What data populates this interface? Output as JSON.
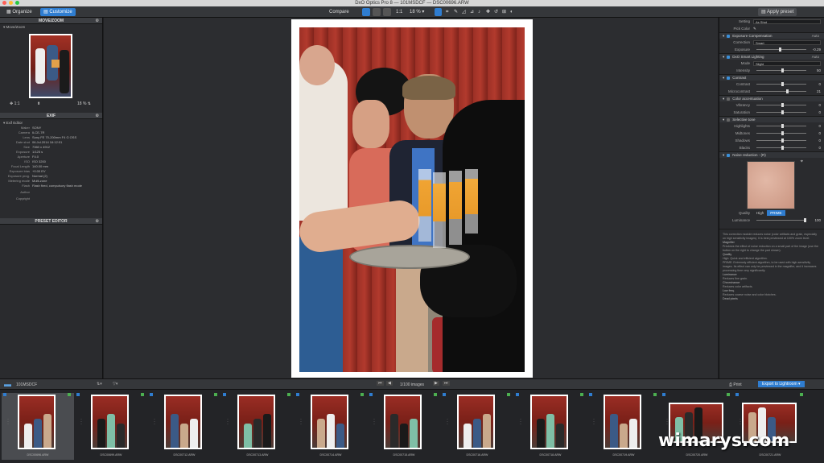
{
  "app": {
    "title": "DxO Optics Pro 8 — 101MSDCF — DSC00696.ARW"
  },
  "toolbar": {
    "tab_organize": "Organize",
    "tab_customize": "Customize",
    "compare": "Compare",
    "zoom_fit": "1:1",
    "zoom_level": "18 %",
    "apply_preset": "Apply preset"
  },
  "left": {
    "move_zoom": {
      "header": "MOVE/ZOOM",
      "sub": "Move/Zoom",
      "fit": "1:1",
      "zoom": "18 %"
    },
    "exif": {
      "header": "EXIF",
      "sub": "Exif Editor",
      "rows": [
        {
          "k": "Maker",
          "v": "SONY"
        },
        {
          "k": "Camera",
          "v": "ILCE-7R"
        },
        {
          "k": "Lens",
          "v": "Sony FE 70-200mm F4 G OSS"
        },
        {
          "k": "Date shot",
          "v": "06.Jul.2014 16:12:01"
        },
        {
          "k": "Size",
          "v": "7360 x 4912"
        },
        {
          "k": "Exposure",
          "v": "1/125 s"
        },
        {
          "k": "Aperture",
          "v": "F4.0"
        },
        {
          "k": "ISO",
          "v": "ISO 3200"
        },
        {
          "k": "Focal Length",
          "v": "140.00 mm"
        },
        {
          "k": "Exposure bias",
          "v": "+0.00 EV"
        },
        {
          "k": "Exposure prog.",
          "v": "Normal (2)"
        },
        {
          "k": "Metering mode",
          "v": "Multi-zone"
        },
        {
          "k": "Flash",
          "v": "Flash fired, compulsory flash mode"
        },
        {
          "k": "Author",
          "v": ""
        },
        {
          "k": "Copyright",
          "v": ""
        }
      ]
    },
    "preset_editor": {
      "header": "PRESET EDITOR"
    }
  },
  "right": {
    "top_rows": [
      {
        "label": "Setting",
        "value": "As Shot"
      },
      {
        "label": "Pick Color",
        "value": ""
      }
    ],
    "exposure": {
      "title": "Exposure Compensation",
      "mode": "Auto",
      "correction_label": "Correction",
      "correction": "Smart",
      "exposure_label": "Exposure",
      "exposure_value": "-0.29"
    },
    "smart_lighting": {
      "title": "DxO Smart Lighting",
      "mode": "Auto",
      "mode_label": "Mode",
      "mode_value": "Slight",
      "intensity_label": "Intensity",
      "intensity_value": "50"
    },
    "contrast": {
      "title": "Contrast",
      "rows": [
        {
          "label": "Contrast",
          "value": "0"
        },
        {
          "label": "Microcontrast",
          "value": "21"
        }
      ]
    },
    "color": {
      "title": "Color accentuation",
      "rows": [
        {
          "label": "Vibrancy",
          "value": "0"
        },
        {
          "label": "Saturation",
          "value": "0"
        }
      ]
    },
    "tone": {
      "title": "Selective tone",
      "rows": [
        {
          "label": "Highlights",
          "value": "0"
        },
        {
          "label": "Midtones",
          "value": "0"
        },
        {
          "label": "Shadows",
          "value": "0"
        },
        {
          "label": "Blacks",
          "value": "0"
        }
      ]
    },
    "noise": {
      "title": "Noise reduction - (R)",
      "quality_label": "Quality",
      "q_high": "High",
      "q_prime": "PRIME",
      "luminance_label": "Luminance",
      "luminance_value": "100"
    },
    "help": [
      {
        "t": "",
        "d": "This correction module reduces noise (color artifacts and grain, especially on high sensitivity images). It is best previewed at 100% zoom level."
      },
      {
        "t": "Magnifier",
        "d": "Previews the effect of noise reduction on a small part of the image (use the button on the right to change the part shown)."
      },
      {
        "t": "Quality",
        "d": "High: Quick and efficient algorithm."
      },
      {
        "t": "",
        "d": "PRIME: Extremely efficient algorithm, to be used with high-sensitivity images. Its effect can only be previewed in the magnifier, and it increases processing time very significantly."
      },
      {
        "t": "Luminance",
        "d": "Reduces fine grain."
      },
      {
        "t": "Chrominance",
        "d": "Reduces color artifacts."
      },
      {
        "t": "Low freq.",
        "d": "Reduces coarse noise and color blotches."
      },
      {
        "t": "Dead pixels",
        "d": ""
      }
    ]
  },
  "filmbar": {
    "folder": "101MSDCF",
    "count": "1/100 images",
    "print": "Print",
    "export": "Export to Lightroom"
  },
  "film": [
    {
      "name": "DSC00696.ARW"
    },
    {
      "name": "DSC00699.ARW"
    },
    {
      "name": "DSC00712.ARW"
    },
    {
      "name": "DSC00713.ARW"
    },
    {
      "name": "DSC00714.ARW"
    },
    {
      "name": "DSC00715.ARW"
    },
    {
      "name": "DSC00716.ARW"
    },
    {
      "name": "DSC00718.ARW"
    },
    {
      "name": "DSC00719.ARW"
    },
    {
      "name": "DSC00720.ARW"
    },
    {
      "name": "DSC00721.ARW"
    }
  ],
  "watermark": "wimarys.com",
  "colors": {
    "accent": "#2f7dd0",
    "curtain": "#8e2b22"
  }
}
